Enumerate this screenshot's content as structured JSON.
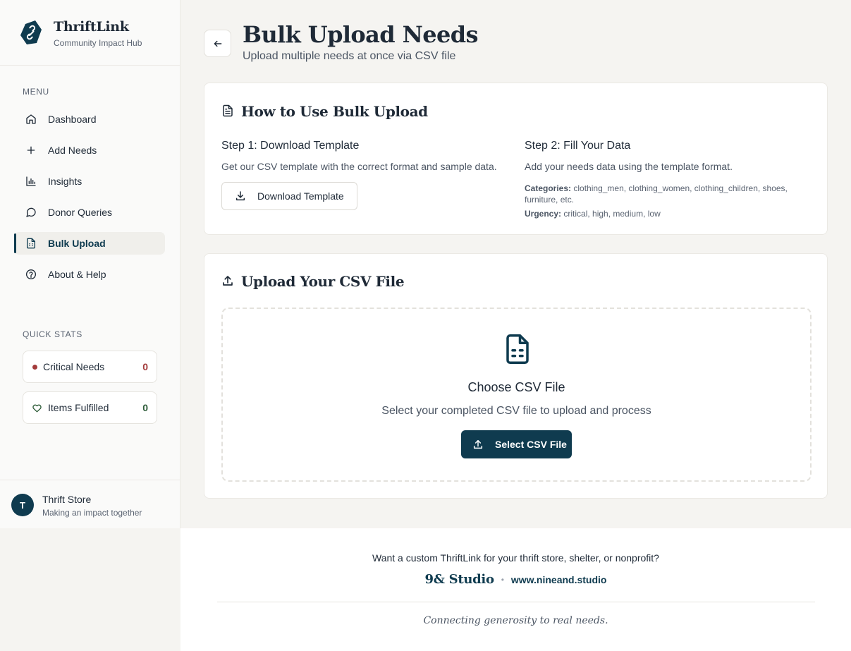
{
  "brand": {
    "name": "ThriftLink",
    "subtitle": "Community Impact Hub"
  },
  "sidebar": {
    "menu_label": "MENU",
    "items": [
      {
        "label": "Dashboard",
        "icon": "home-icon"
      },
      {
        "label": "Add Needs",
        "icon": "plus-icon"
      },
      {
        "label": "Insights",
        "icon": "bar-chart-icon"
      },
      {
        "label": "Donor Queries",
        "icon": "message-circle-icon"
      },
      {
        "label": "Bulk Upload",
        "icon": "file-spreadsheet-icon",
        "active": true
      },
      {
        "label": "About & Help",
        "icon": "help-circle-icon"
      }
    ],
    "quick_stats_label": "QUICK STATS",
    "stats": [
      {
        "label": "Critical Needs",
        "value": "0",
        "color": "#a33b3b"
      },
      {
        "label": "Items Fulfilled",
        "value": "0",
        "color": "#2f5d3a"
      }
    ]
  },
  "user": {
    "initial": "T",
    "name": "Thrift Store",
    "subtitle": "Making an impact together"
  },
  "header": {
    "title": "Bulk Upload Needs",
    "subtitle": "Upload multiple needs at once via CSV file"
  },
  "howto": {
    "title": "How to Use Bulk Upload",
    "step1_title": "Step 1: Download Template",
    "step1_text": "Get our CSV template with the correct format and sample data.",
    "download_label": "Download Template",
    "step2_title": "Step 2: Fill Your Data",
    "step2_text": "Add your needs data using the template format.",
    "categories_label": "Categories:",
    "categories_value": "clothing_men, clothing_women, clothing_children, shoes, furniture, etc.",
    "urgency_label": "Urgency:",
    "urgency_value": "critical, high, medium, low"
  },
  "upload": {
    "title": "Upload Your CSV File",
    "choose_title": "Choose CSV File",
    "choose_text": "Select your completed CSV file to upload and process",
    "select_label": "Select CSV File"
  },
  "footer": {
    "question": "Want a custom ThriftLink for your thrift store, shelter, or nonprofit?",
    "studio": "9& Studio",
    "separator": "•",
    "url": "www.nineand.studio",
    "tagline": "Connecting generosity to real needs."
  },
  "colors": {
    "primary": "#0f3b4f",
    "critical": "#a33b3b",
    "fulfilled": "#2f5d3a"
  }
}
